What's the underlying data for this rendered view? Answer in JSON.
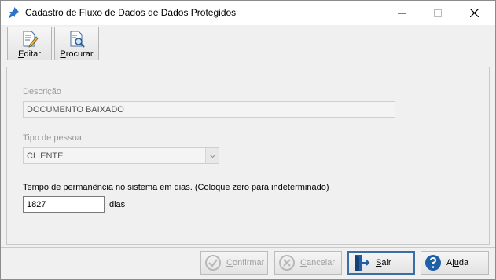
{
  "window": {
    "title": "Cadastro de Fluxo de Dados de Dados Protegidos"
  },
  "toolbar": {
    "editar": {
      "prefix": "",
      "accel": "E",
      "rest": "ditar"
    },
    "procurar": {
      "prefix": "",
      "accel": "P",
      "rest": "rocurar"
    }
  },
  "form": {
    "descricao_label": "Descrição",
    "descricao_value": "DOCUMENTO BAIXADO",
    "tipo_label": "Tipo de pessoa",
    "tipo_value": "CLIENTE",
    "tempo_label": "Tempo de permanência no sistema em dias. (Coloque zero para indeterminado)",
    "tempo_value": "1827",
    "dias_label": "dias"
  },
  "buttons": {
    "confirmar": {
      "accel": "C",
      "rest": "onfirmar"
    },
    "cancelar": {
      "accel": "C",
      "rest": "ancelar"
    },
    "sair": {
      "accel": "S",
      "rest": "air"
    },
    "ajuda": {
      "pre": "Aj",
      "accel": "u",
      "rest": "da"
    }
  },
  "colors": {
    "accent": "#3b6ea5",
    "help_icon": "#1f5fa8",
    "confirm_icon_disabled": "#b8b8b8"
  },
  "icons": {
    "title": "pin-icon",
    "editar": "edit-document-icon",
    "procurar": "search-document-icon",
    "confirmar": "check-circle-icon",
    "cancelar": "x-circle-icon",
    "sair": "exit-door-icon",
    "ajuda": "help-icon"
  }
}
